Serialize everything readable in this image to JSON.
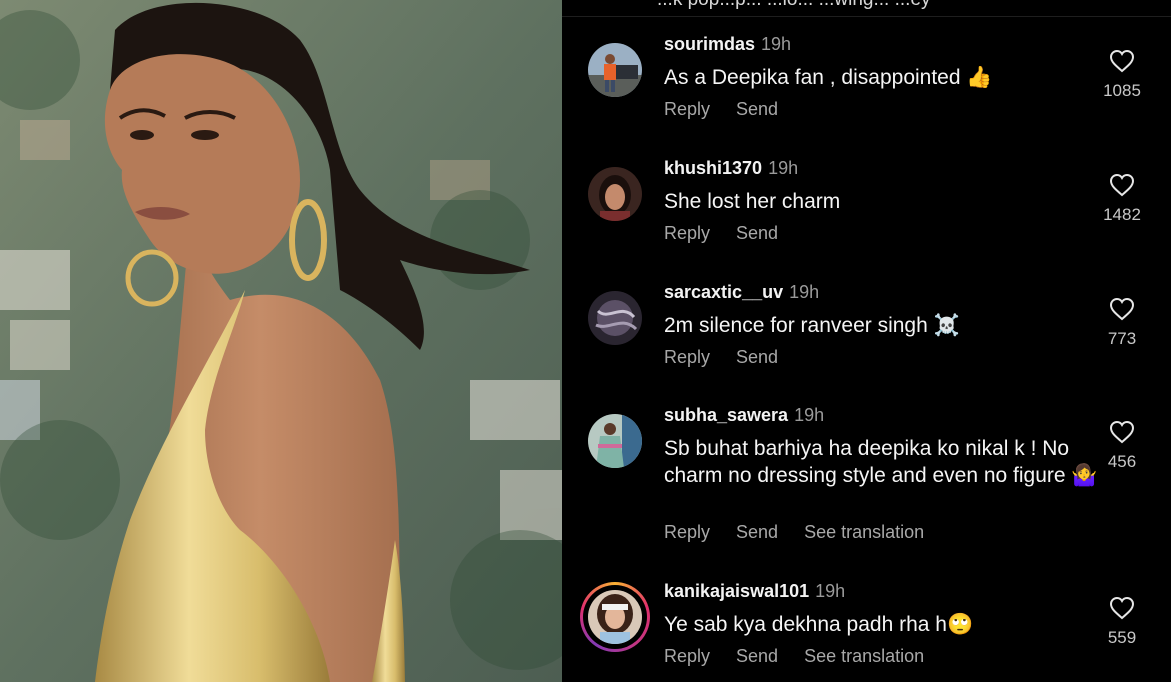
{
  "top_strip": {
    "partial_text": "...k pop...p... ...lo... ...wing... ...ey"
  },
  "comments": [
    {
      "username": "sourimdas",
      "time": "19h",
      "text": "As a Deepika fan , disappointed 👍",
      "actions": [
        "Reply",
        "Send"
      ],
      "likes": "1085"
    },
    {
      "username": "khushi1370",
      "time": "19h",
      "text": "She lost her charm",
      "actions": [
        "Reply",
        "Send"
      ],
      "likes": "1482"
    },
    {
      "username": "sarcaxtic__uv",
      "time": "19h",
      "text": "2m silence for ranveer singh ☠️",
      "actions": [
        "Reply",
        "Send"
      ],
      "likes": "773"
    },
    {
      "username": "subha_sawera",
      "time": "19h",
      "text": "Sb buhat barhiya ha deepika ko nikal k ! No charm no dressing style and even no figure 🤷‍♀️",
      "actions": [
        "Reply",
        "Send",
        "See translation"
      ],
      "likes": "456"
    },
    {
      "username": "kanikajaiswal101",
      "time": "19h",
      "text": "Ye sab kya dekhna padh rha h🙄",
      "actions": [
        "Reply",
        "Send",
        "See translation"
      ],
      "likes": "559"
    }
  ],
  "icons": {
    "like": "heart-outline-icon"
  },
  "colors": {
    "background": "#000000",
    "username": "#f3f3f3",
    "muted": "#9a9a9a",
    "story_ring": [
      "#f9b233",
      "#e1306c",
      "#833ab4"
    ]
  }
}
